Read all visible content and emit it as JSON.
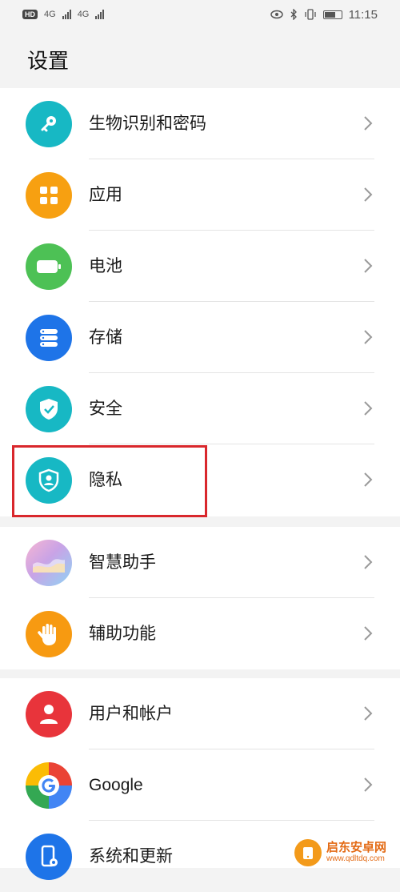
{
  "status_bar": {
    "left_badge": "HD",
    "network_1": "4G",
    "network_2": "4G",
    "time": "11:15",
    "icons": [
      "eye-icon",
      "bluetooth-icon",
      "vibrate-icon",
      "battery-icon"
    ]
  },
  "header": {
    "title": "设置"
  },
  "sections": [
    {
      "items": [
        {
          "label": "生物识别和密码",
          "icon": "key-icon",
          "color": "#17b8c4"
        },
        {
          "label": "应用",
          "icon": "apps-grid-icon",
          "color": "#f7a011"
        },
        {
          "label": "电池",
          "icon": "battery-icon",
          "color": "#4dc155"
        },
        {
          "label": "存储",
          "icon": "storage-icon",
          "color": "#1e74e8"
        },
        {
          "label": "安全",
          "icon": "shield-check-icon",
          "color": "#17b8c4"
        },
        {
          "label": "隐私",
          "icon": "privacy-shield-icon",
          "color": "#17b8c4",
          "highlighted": true
        }
      ]
    },
    {
      "items": [
        {
          "label": "智慧助手",
          "icon": "assistant-icon",
          "color": "#c9a3e6"
        },
        {
          "label": "辅助功能",
          "icon": "hand-icon",
          "color": "#f79a11"
        }
      ]
    },
    {
      "items": [
        {
          "label": "用户和帐户",
          "icon": "user-icon",
          "color": "#e8343b"
        },
        {
          "label": "Google",
          "icon": "google-icon",
          "color": "#ffffff"
        },
        {
          "label": "系统和更新",
          "icon": "system-update-icon",
          "color": "#1e74e8"
        }
      ]
    }
  ],
  "watermark": {
    "text": "启东安卓网",
    "url": "www.qdltdq.com"
  }
}
